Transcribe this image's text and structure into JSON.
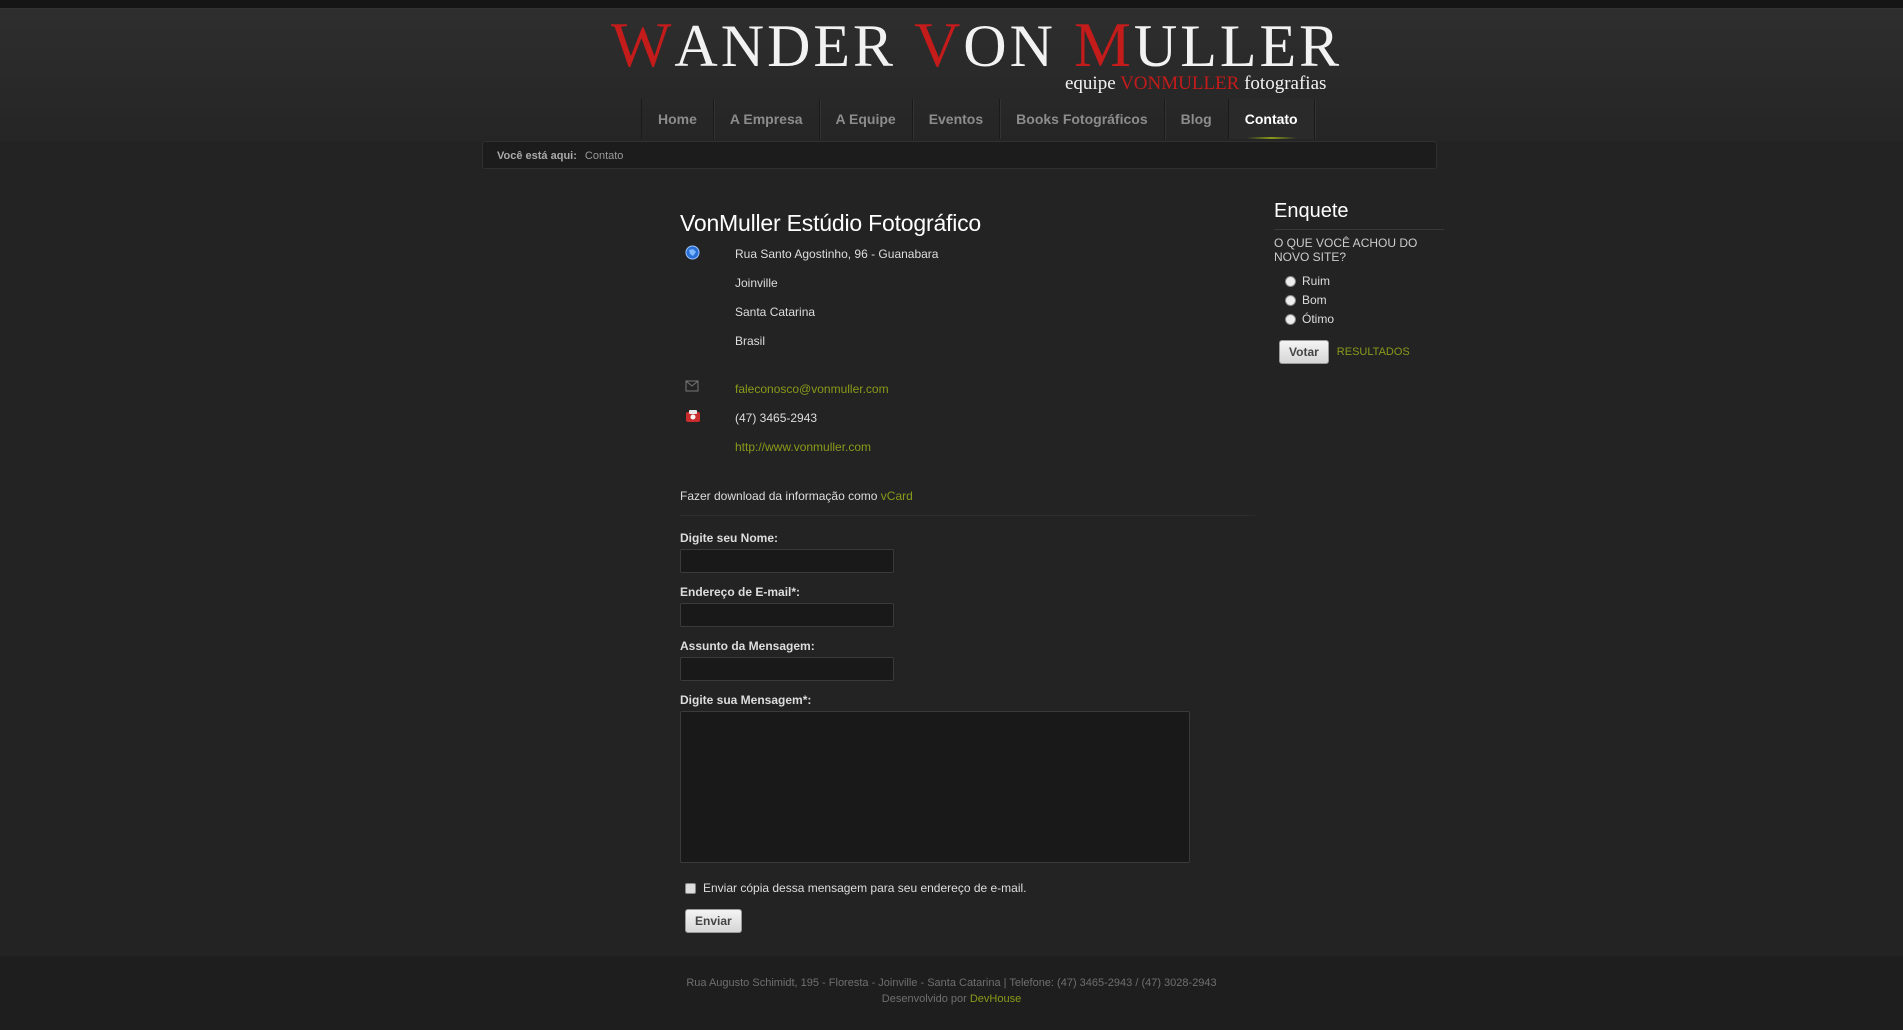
{
  "logo": {
    "w": "W",
    "ander": "ANDER ",
    "v": "V",
    "on": "ON ",
    "m": "M",
    "uller": "ULLER",
    "tag_pre": "equipe ",
    "tag_red": "VONMULLER",
    "tag_post": " fotografias"
  },
  "nav": [
    "Home",
    "A Empresa",
    "A Equipe",
    "Eventos",
    "Books Fotográficos",
    "Blog",
    "Contato"
  ],
  "breadcrumb": {
    "label": "Você está aqui:",
    "current": "Contato"
  },
  "contact": {
    "name": "VonMuller Estúdio Fotográfico",
    "street": "Rua Santo Agostinho, 96 - Guanabara",
    "city": "Joinville",
    "state": "Santa Catarina",
    "country": "Brasil",
    "email": "faleconosco@vonmuller.com",
    "phone": "(47) 3465-2943",
    "website": "http://www.vonmuller.com",
    "vcard_text": "Fazer download da informação como ",
    "vcard_link": "vCard"
  },
  "form": {
    "name_label": "Digite seu Nome:",
    "email_label": "Endereço de E-mail*:",
    "subject_label": "Assunto da Mensagem:",
    "message_label": "Digite sua Mensagem*:",
    "copy_label": "Enviar cópia dessa mensagem para seu endereço de e-mail.",
    "submit": "Enviar"
  },
  "poll": {
    "title": "Enquete",
    "question": "O QUE VOCÊ ACHOU DO NOVO SITE?",
    "options": [
      "Ruim",
      "Bom",
      "Ótimo"
    ],
    "vote": "Votar",
    "results": "RESULTADOS"
  },
  "footer": {
    "address": "Rua Augusto Schimidt, 195 - Floresta - Joinville - Santa Catarina | Telefone: (47) 3465-2943 / (47) 3028-2943",
    "dev_text": "Desenvolvido por ",
    "dev_link": "DevHouse"
  },
  "colors": {
    "accent": "#8a9a1a",
    "logo_red": "#c41b1b",
    "background": "#232323"
  },
  "icons": [
    "address-icon",
    "email-icon",
    "phone-icon"
  ]
}
